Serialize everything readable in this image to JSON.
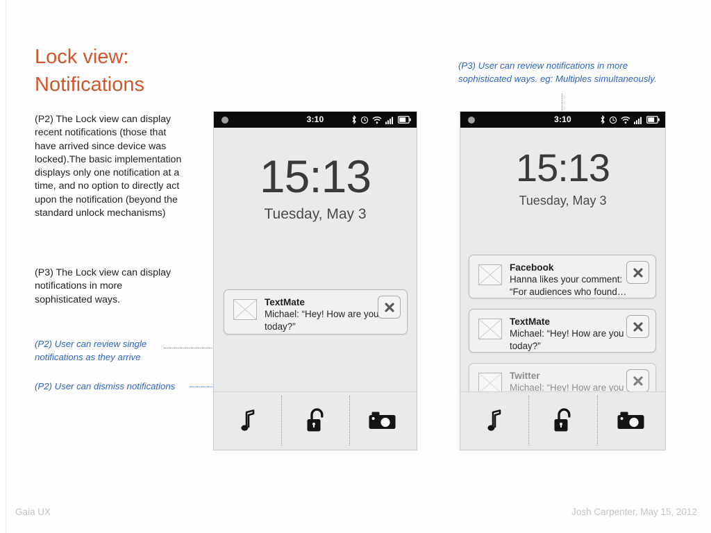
{
  "slide": {
    "title_line1": "Lock view:",
    "title_line2": "Notifications",
    "title_color": "#d2562a",
    "accent_blue": "#2f63c4"
  },
  "paragraphs": {
    "p2": "(P2) The Lock view can display recent notifications (those that have arrived since device was locked).The basic implementation displays only one notification at a time, and no option to directly act upon the notification (beyond the standard unlock mechanisms)",
    "p3": "(P3) The Lock view can display notifications in more sophisticated ways."
  },
  "annotations": {
    "review_single": "(P2) User can review single notifications as they arrive",
    "dismiss": "(P2) User can dismiss notifications",
    "top_right": "(P3) User can review notifications in more sophisticated ways. eg: Multiples simultaneously."
  },
  "phone_left": {
    "status": {
      "time": "3:10",
      "icons": [
        "bluetooth-icon",
        "alarm-clock-icon",
        "wifi-icon",
        "signal-bars-icon",
        "battery-icon"
      ]
    },
    "clock": "15:13",
    "date": "Tuesday, May 3",
    "notification": {
      "app": "TextMate",
      "message": "Michael: “Hey! How are you today?”",
      "close_label": "✕"
    },
    "toolbar": [
      "music-note-icon",
      "unlocked-padlock-icon",
      "camera-icon"
    ]
  },
  "phone_right": {
    "status": {
      "time": "3:10",
      "icons": [
        "bluetooth-icon",
        "alarm-clock-icon",
        "wifi-icon",
        "signal-bars-icon",
        "battery-icon"
      ]
    },
    "clock": "15:13",
    "date": "Tuesday, May 3",
    "notifications": [
      {
        "app": "Facebook",
        "message": "Hanna likes your comment: “For audiences who found…"
      },
      {
        "app": "TextMate",
        "message": "Michael: “Hey! How are you today?”"
      },
      {
        "app": "Twitter",
        "message": "Michael: “Hey! How are you today?”"
      }
    ],
    "toolbar": [
      "music-note-icon",
      "unlocked-padlock-icon",
      "camera-icon"
    ]
  },
  "footer": {
    "left": "Gaia UX",
    "right": "Josh Carpenter, May 15, 2012"
  }
}
